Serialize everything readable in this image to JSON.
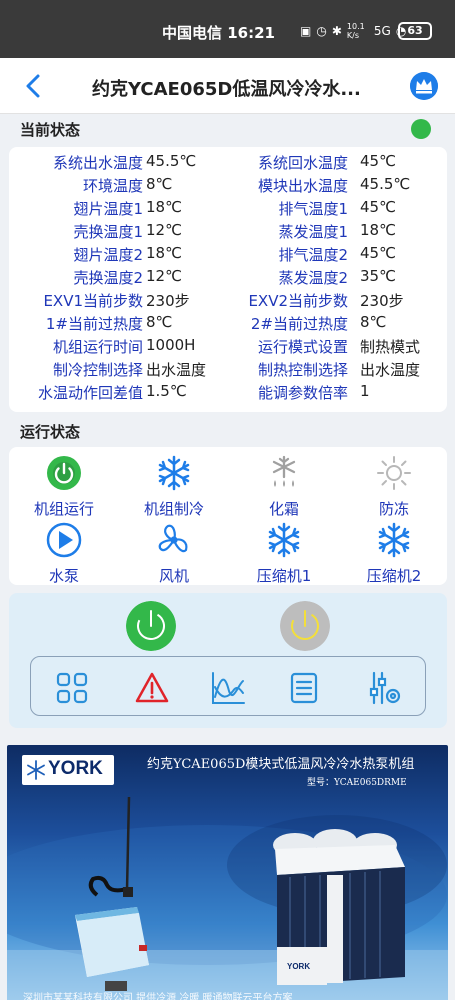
{
  "status_bar": {
    "carrier_time": "中国电信 16:21",
    "network_speed": "10.1 K/s",
    "network_type": "5G",
    "battery": "63",
    "icons": [
      "nfc-icon",
      "alarm-icon",
      "bluetooth-icon",
      "signal-icon",
      "wifi-icon"
    ]
  },
  "header": {
    "title": "约克YCAE065D低温风冷冷水...",
    "accent": "#1e7de8"
  },
  "current_status": {
    "title": "当前状态",
    "indicator_color": "#33b84a",
    "rows": [
      {
        "l1": "系统出水温度",
        "v1": "45.5℃",
        "l2": "系统回水温度",
        "v2": "45℃"
      },
      {
        "l1": "环境温度",
        "v1": "8℃",
        "l2": "模块出水温度",
        "v2": "45.5℃"
      },
      {
        "l1": "翅片温度1",
        "v1": "18℃",
        "l2": "排气温度1",
        "v2": "45℃"
      },
      {
        "l1": "壳换温度1",
        "v1": "12℃",
        "l2": "蒸发温度1",
        "v2": "18℃"
      },
      {
        "l1": "翅片温度2",
        "v1": "18℃",
        "l2": "排气温度2",
        "v2": "45℃"
      },
      {
        "l1": "壳换温度2",
        "v1": "12℃",
        "l2": "蒸发温度2",
        "v2": "35℃"
      },
      {
        "l1": "EXV1当前步数",
        "v1": "230步",
        "l2": "EXV2当前步数",
        "v2": "230步"
      },
      {
        "l1": "1#当前过热度",
        "v1": "8℃",
        "l2": "2#当前过热度",
        "v2": "8℃"
      },
      {
        "l1": "机组运行时间",
        "v1": "1000H",
        "l2": "运行模式设置",
        "v2": "制热模式"
      },
      {
        "l1": "制冷控制选择",
        "v1": "出水温度",
        "l2": "制热控制选择",
        "v2": "出水温度"
      },
      {
        "l1": "水温动作回差值",
        "v1": "1.5℃",
        "l2": "能调参数倍率",
        "v2": "1"
      }
    ]
  },
  "run_status": {
    "title": "运行状态",
    "items": [
      {
        "label": "机组运行",
        "icon": "power-on-icon"
      },
      {
        "label": "机组制冷",
        "icon": "snowflake-icon"
      },
      {
        "label": "化霜",
        "icon": "defrost-icon"
      },
      {
        "label": "防冻",
        "icon": "sun-icon"
      },
      {
        "label": "水泵",
        "icon": "play-icon"
      },
      {
        "label": "风机",
        "icon": "fan-icon"
      },
      {
        "label": "压缩机1",
        "icon": "snowflake-icon"
      },
      {
        "label": "压缩机2",
        "icon": "snowflake-icon"
      }
    ]
  },
  "controls": {
    "power_on_color": "#33b84a",
    "power_off_color": "#bdbdbd",
    "tools": [
      "grid-icon",
      "alarm-warning-icon",
      "chart-icon",
      "list-icon",
      "settings-sliders-icon"
    ]
  },
  "banner": {
    "logo_text": "YORK",
    "title": "约克YCAE065D模块式低温风冷冷水热泵机组",
    "model": "型号：YCAE065DRME",
    "footer": "深圳市某某科技有限公司 提供冷源 冷暖 暖通物联云平台方案"
  }
}
